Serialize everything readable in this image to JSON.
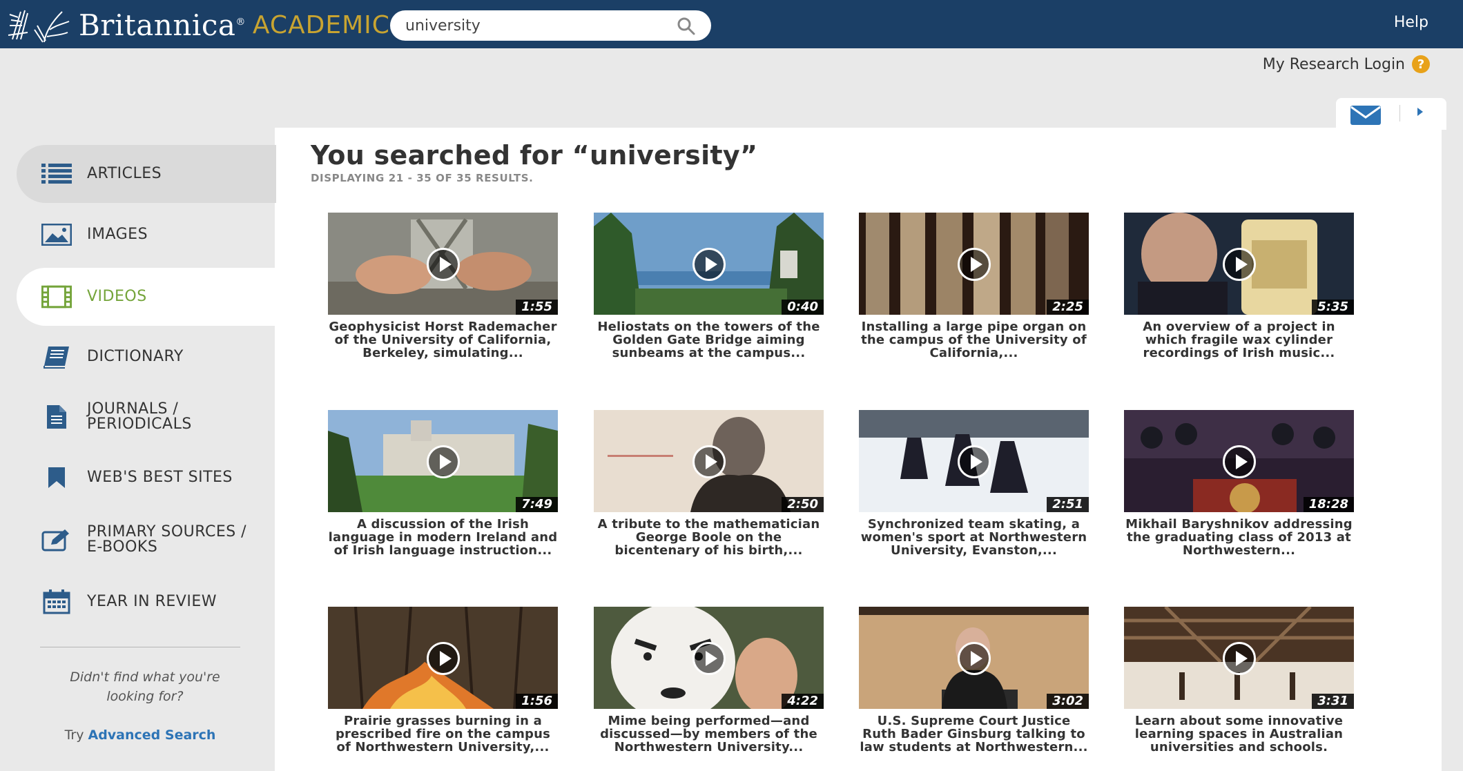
{
  "brand": {
    "name": "Britannica",
    "registered": "®",
    "product": "ACADEMIC"
  },
  "header": {
    "search_value": "university",
    "help_label": "Help"
  },
  "account": {
    "login_label": "My Research Login",
    "help_glyph": "?"
  },
  "sidebar": {
    "items": [
      {
        "label": "ARTICLES",
        "icon": "list-icon"
      },
      {
        "label": "IMAGES",
        "icon": "image-icon"
      },
      {
        "label": "VIDEOS",
        "icon": "film-icon"
      },
      {
        "label": "DICTIONARY",
        "icon": "book-icon"
      },
      {
        "label": "JOURNALS / PERIODICALS",
        "icon": "document-icon"
      },
      {
        "label": "WEB'S BEST SITES",
        "icon": "bookmark-icon"
      },
      {
        "label": "PRIMARY SOURCES / E-BOOKS",
        "icon": "edit-icon"
      },
      {
        "label": "YEAR IN REVIEW",
        "icon": "calendar-icon"
      }
    ],
    "not_found_text": "Didn't find what you're looking for?",
    "try_label": "Try",
    "advanced_search_label": "Advanced Search"
  },
  "results": {
    "title": "You searched for “university”",
    "count_text": "DISPLAYING 21 - 35 OF 35 RESULTS.",
    "videos": [
      {
        "duration": "1:55",
        "caption": "Geophysicist Horst Rademacher of the University of California, Berkeley, simulating..."
      },
      {
        "duration": "0:40",
        "caption": "Heliostats on the towers of the Golden Gate Bridge aiming sunbeams at the campus..."
      },
      {
        "duration": "2:25",
        "caption": "Installing a large pipe organ on the campus of the University of California,..."
      },
      {
        "duration": "5:35",
        "caption": "An overview of a project in which fragile wax cylinder recordings of Irish music..."
      },
      {
        "duration": "7:49",
        "caption": "A discussion of the Irish language in modern Ireland and of Irish language instruction..."
      },
      {
        "duration": "2:50",
        "caption": "A tribute to the mathematician George Boole on the bicentenary of his birth,..."
      },
      {
        "duration": "2:51",
        "caption": "Synchronized team skating, a women's sport at Northwestern University, Evanston,..."
      },
      {
        "duration": "18:28",
        "caption": "Mikhail Baryshnikov addressing the graduating class of 2013 at Northwestern..."
      },
      {
        "duration": "1:56",
        "caption": "Prairie grasses burning in a prescribed fire on the campus of Northwestern University,..."
      },
      {
        "duration": "4:22",
        "caption": "Mime being performed—and discussed—by members of the Northwestern University..."
      },
      {
        "duration": "3:02",
        "caption": "U.S. Supreme Court Justice Ruth Bader Ginsburg talking to law students at Northwestern..."
      },
      {
        "duration": "3:31",
        "caption": "Learn about some innovative learning spaces in Australian universities and schools."
      }
    ]
  },
  "colors": {
    "header_bg": "#1b3f66",
    "accent_gold": "#c8a431",
    "active_green": "#74a43a",
    "link_blue": "#2d74b6",
    "icon_blue": "#2d5c8a"
  }
}
